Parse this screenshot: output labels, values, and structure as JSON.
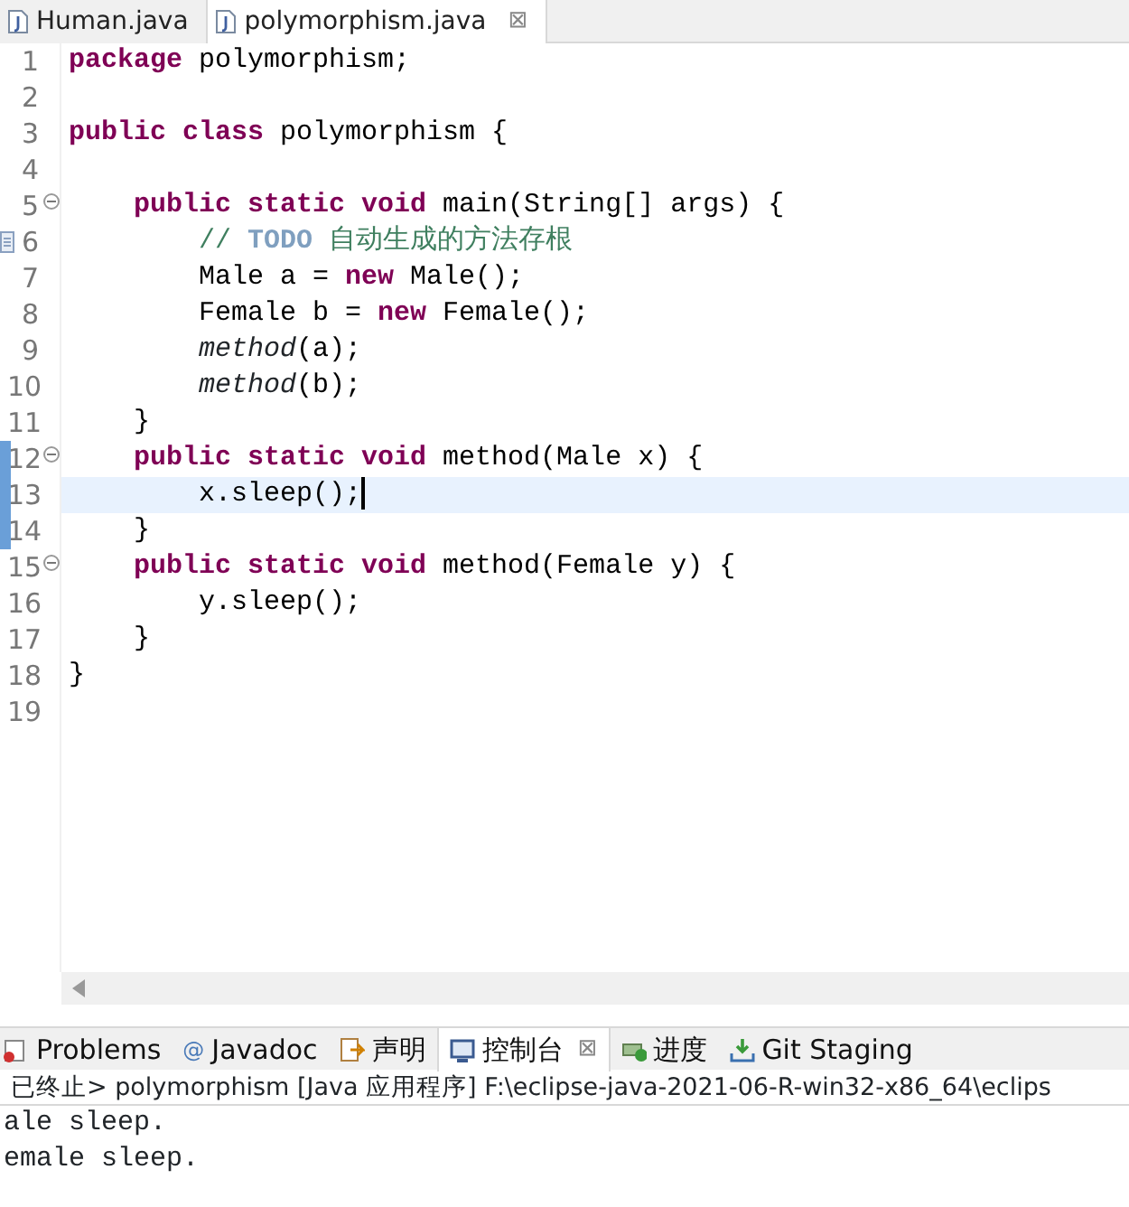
{
  "editor_tabs": [
    {
      "label": "Human.java",
      "selected": false,
      "closable": false
    },
    {
      "label": "polymorphism.java",
      "selected": true,
      "closable": true
    }
  ],
  "close_glyph": "⊠",
  "code_lines": [
    {
      "number": "1",
      "tokens": [
        {
          "kind": "kw",
          "text": "package"
        },
        {
          "kind": "plain",
          "text": " polymorphism;"
        }
      ]
    },
    {
      "number": "2"
    },
    {
      "number": "3",
      "tokens": [
        {
          "kind": "kw",
          "text": "public class"
        },
        {
          "kind": "plain",
          "text": " polymorphism {"
        }
      ]
    },
    {
      "number": "4"
    },
    {
      "number": "5",
      "fold": true,
      "tokens": [
        {
          "kind": "kw",
          "text": "    public static void"
        },
        {
          "kind": "plain",
          "text": " main(String[] args) {"
        }
      ]
    },
    {
      "number": "6",
      "task": true,
      "tokens": [
        {
          "kind": "comment",
          "text": "        // "
        },
        {
          "kind": "todo",
          "text": "TODO"
        },
        {
          "kind": "comment",
          "text": " 自动生成的方法存根"
        }
      ]
    },
    {
      "number": "7",
      "tokens": [
        {
          "kind": "plain",
          "text": "        Male a = "
        },
        {
          "kind": "kw",
          "text": "new"
        },
        {
          "kind": "plain",
          "text": " Male();"
        }
      ]
    },
    {
      "number": "8",
      "tokens": [
        {
          "kind": "plain",
          "text": "        Female b = "
        },
        {
          "kind": "kw",
          "text": "new"
        },
        {
          "kind": "plain",
          "text": " Female();"
        }
      ]
    },
    {
      "number": "9",
      "tokens": [
        {
          "kind": "call",
          "text": "        method"
        },
        {
          "kind": "plain",
          "text": "(a);"
        }
      ]
    },
    {
      "number": "10",
      "tokens": [
        {
          "kind": "call",
          "text": "        method"
        },
        {
          "kind": "plain",
          "text": "(b);"
        }
      ]
    },
    {
      "number": "11",
      "tokens": [
        {
          "kind": "plain",
          "text": "    }"
        }
      ]
    },
    {
      "number": "12",
      "fold": true,
      "changed": true,
      "tokens": [
        {
          "kind": "kw",
          "text": "    public static void"
        },
        {
          "kind": "plain",
          "text": " method(Male x) {"
        }
      ]
    },
    {
      "number": "13",
      "changed": true,
      "current": true,
      "tokens": [
        {
          "kind": "plain",
          "text": "        x.sleep();"
        }
      ]
    },
    {
      "number": "14",
      "changed": true,
      "tokens": [
        {
          "kind": "plain",
          "text": "    }"
        }
      ]
    },
    {
      "number": "15",
      "fold": true,
      "tokens": [
        {
          "kind": "kw",
          "text": "    public static void"
        },
        {
          "kind": "plain",
          "text": " method(Female y) {"
        }
      ]
    },
    {
      "number": "16",
      "tokens": [
        {
          "kind": "plain",
          "text": "        y.sleep();"
        }
      ]
    },
    {
      "number": "17",
      "tokens": [
        {
          "kind": "plain",
          "text": "    }"
        }
      ]
    },
    {
      "number": "18",
      "tokens": [
        {
          "kind": "plain",
          "text": "}"
        }
      ]
    },
    {
      "number": "19"
    }
  ],
  "view_tabs": [
    {
      "kind": "problems",
      "label": "Problems",
      "selected": false
    },
    {
      "kind": "javadoc",
      "glyph": "@",
      "label": "Javadoc",
      "selected": false
    },
    {
      "kind": "declaration",
      "label": "声明",
      "selected": false
    },
    {
      "kind": "console",
      "label": "控制台",
      "selected": true
    },
    {
      "kind": "progress",
      "label": "进度",
      "selected": false
    },
    {
      "kind": "git",
      "label": "Git Staging",
      "selected": false
    }
  ],
  "console": {
    "header": "已终止> polymorphism [Java 应用程序] F:\\eclipse-java-2021-06-R-win32-x86_64\\eclips",
    "output": [
      "ale sleep.",
      "emale sleep."
    ]
  }
}
